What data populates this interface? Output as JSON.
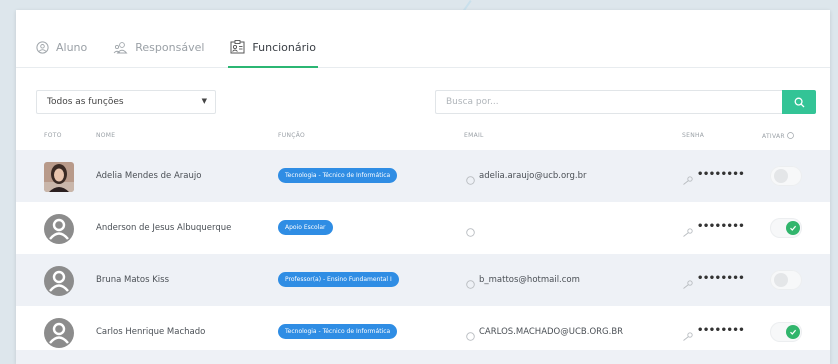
{
  "tabs": [
    {
      "label": "Aluno",
      "icon": "student-icon",
      "active": false
    },
    {
      "label": "Responsável",
      "icon": "guardian-icon",
      "active": false
    },
    {
      "label": "Funcionário",
      "icon": "employee-icon",
      "active": true
    }
  ],
  "filters": {
    "role_select": "Todos as funções",
    "search_placeholder": "Busca por..."
  },
  "table": {
    "headers": {
      "foto": "FOTO",
      "nome": "NOME",
      "funcao": "FUNÇÃO",
      "email": "EMAIL",
      "senha": "SENHA",
      "ativar": "ATIVAR"
    },
    "rows": [
      {
        "name": "Adelia Mendes de Araujo",
        "role": "Tecnologia - Técnico de Informática",
        "email": "adelia.araujo@ucb.org.br",
        "password": "••••••••",
        "active": false,
        "photo": "photo"
      },
      {
        "name": "Anderson de Jesus Albuquerque",
        "role": "Apoio Escolar",
        "email": "",
        "password": "••••••••",
        "active": true,
        "photo": "avatar-placeholder"
      },
      {
        "name": "Bruna Matos Kiss",
        "role": "Professor(a) - Ensino Fundamental I",
        "email": "b_mattos@hotmail.com",
        "password": "••••••••",
        "active": false,
        "photo": "avatar-placeholder"
      },
      {
        "name": "Carlos Henrique Machado",
        "role": "Tecnologia - Técnico de Informática",
        "email": "CARLOS.MACHADO@UCB.ORG.BR",
        "password": "••••••••",
        "active": true,
        "photo": "avatar-placeholder"
      }
    ]
  },
  "colors": {
    "accent_green": "#33c496",
    "badge_blue": "#2f8de4",
    "toggle_on": "#31b56c",
    "row_shade": "#eef1f6"
  }
}
